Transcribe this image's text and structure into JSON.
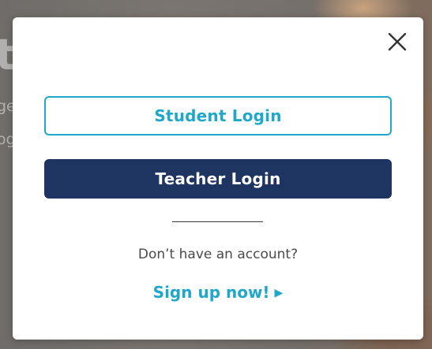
{
  "background_page": {
    "visible_fragments": [
      "t",
      "ge",
      "og"
    ]
  },
  "modal": {
    "close_icon": "close-icon",
    "student_login_label": "Student Login",
    "teacher_login_label": "Teacher Login",
    "no_account_text": "Don’t have an account?",
    "signup_label": "Sign up now!",
    "signup_chevron_icon": "chevron-right-icon",
    "colors": {
      "accent": "#1fa8c9",
      "primary": "#1e3461",
      "text": "#4a4a4a"
    }
  }
}
